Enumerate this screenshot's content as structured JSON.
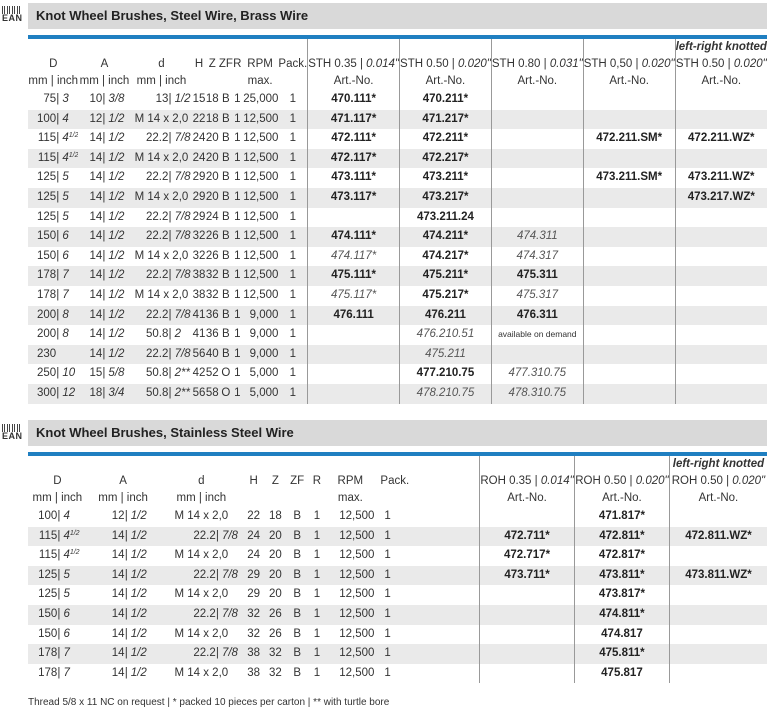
{
  "section1": {
    "ean": "EAN",
    "title": "Knot Wheel Brushes, Steel Wire, Brass Wire",
    "knotted_header": "left-right knotted",
    "hdr": {
      "D": "D",
      "A": "A",
      "d": "d",
      "H": "H",
      "Z": "Z",
      "ZF": "ZF",
      "R": "R",
      "RPM": "RPM",
      "Pack": "Pack.",
      "max": "max.",
      "unit_D": "mm | inch",
      "unit_A": "mm | inch",
      "unit_d": "mm | inch",
      "p1a": "STH 0.35 |",
      "p1b": "0.014\"",
      "p2a": "STH 0.50 |",
      "p2b": "0.020\"",
      "p3a": "STH 0.80 |",
      "p3b": "0.031\"",
      "p4a": "STH 0,50 |",
      "p4b": "0.020\"",
      "p5a": "STH 0.50 |",
      "p5b": "0.020\"",
      "art": "Art.-No."
    },
    "rows": [
      {
        "Dm": "75",
        "Di": "3",
        "Am": "10",
        "Ai": "3/8",
        "dm": "13",
        "di": "1/2",
        "H": "15",
        "Z": "18",
        "ZF": "B",
        "R": "1",
        "RPM": "25,000",
        "P": "1",
        "a1": "470.111*",
        "a2": "470.211*",
        "a3": "",
        "a4": "",
        "a5": ""
      },
      {
        "Dm": "100",
        "Di": "4",
        "Am": "12",
        "Ai": "1/2",
        "dm": "M 14 x 2,0",
        "di": "",
        "H": "22",
        "Z": "18",
        "ZF": "B",
        "R": "1",
        "RPM": "12,500",
        "P": "1",
        "a1": "471.117*",
        "a2": "471.217*",
        "a3": "",
        "a4": "",
        "a5": ""
      },
      {
        "Dm": "115",
        "Di": "4",
        "Dsup": "1/2",
        "Am": "14",
        "Ai": "1/2",
        "dm": "22.2",
        "di": "7/8",
        "H": "24",
        "Z": "20",
        "ZF": "B",
        "R": "1",
        "RPM": "12,500",
        "P": "1",
        "a1": "472.111*",
        "a2": "472.211*",
        "a3": "",
        "a4": "472.211.SM*",
        "a5": "472.211.WZ*"
      },
      {
        "Dm": "115",
        "Di": "4",
        "Dsup": "1/2",
        "Am": "14",
        "Ai": "1/2",
        "dm": "M 14 x 2,0",
        "di": "",
        "H": "24",
        "Z": "20",
        "ZF": "B",
        "R": "1",
        "RPM": "12,500",
        "P": "1",
        "a1": "472.117*",
        "a2": "472.217*",
        "a3": "",
        "a4": "",
        "a5": ""
      },
      {
        "Dm": "125",
        "Di": "5",
        "Am": "14",
        "Ai": "1/2",
        "dm": "22.2",
        "di": "7/8",
        "H": "29",
        "Z": "20",
        "ZF": "B",
        "R": "1",
        "RPM": "12,500",
        "P": "1",
        "a1": "473.111*",
        "a2": "473.211*",
        "a3": "",
        "a4": "473.211.SM*",
        "a5": "473.211.WZ*"
      },
      {
        "Dm": "125",
        "Di": "5",
        "Am": "14",
        "Ai": "1/2",
        "dm": "M 14 x 2,0",
        "di": "",
        "H": "29",
        "Z": "20",
        "ZF": "B",
        "R": "1",
        "RPM": "12,500",
        "P": "1",
        "a1": "473.117*",
        "a2": "473.217*",
        "a3": "",
        "a4": "",
        "a5": "473.217.WZ*"
      },
      {
        "Dm": "125",
        "Di": "5",
        "Am": "14",
        "Ai": "1/2",
        "dm": "22.2",
        "di": "7/8",
        "H": "29",
        "Z": "24",
        "ZF": "B",
        "R": "1",
        "RPM": "12,500",
        "P": "1",
        "a1": "",
        "a2": "473.211.24",
        "a3": "",
        "a4": "",
        "a5": ""
      },
      {
        "Dm": "150",
        "Di": "6",
        "Am": "14",
        "Ai": "1/2",
        "dm": "22.2",
        "di": "7/8",
        "H": "32",
        "Z": "26",
        "ZF": "B",
        "R": "1",
        "RPM": "12,500",
        "P": "1",
        "a1": "474.111*",
        "a2": "474.211*",
        "a3": "474.311",
        "a4": "",
        "a5": ""
      },
      {
        "Dm": "150",
        "Di": "6",
        "Am": "14",
        "Ai": "1/2",
        "dm": "M 14 x 2,0",
        "di": "",
        "H": "32",
        "Z": "26",
        "ZF": "B",
        "R": "1",
        "RPM": "12,500",
        "P": "1",
        "a1": "474.117*",
        "a2": "474.217*",
        "a3": "474.317",
        "a4": "",
        "a5": ""
      },
      {
        "Dm": "178",
        "Di": "7",
        "Am": "14",
        "Ai": "1/2",
        "dm": "22.2",
        "di": "7/8",
        "H": "38",
        "Z": "32",
        "ZF": "B",
        "R": "1",
        "RPM": "12,500",
        "P": "1",
        "a1": "475.111*",
        "a2": "475.211*",
        "a3": "475.311",
        "a4": "",
        "a5": ""
      },
      {
        "Dm": "178",
        "Di": "7",
        "Am": "14",
        "Ai": "1/2",
        "dm": "M 14 x 2,0",
        "di": "",
        "H": "38",
        "Z": "32",
        "ZF": "B",
        "R": "1",
        "RPM": "12,500",
        "P": "1",
        "a1": "475.117*",
        "a2": "475.217*",
        "a3": "475.317",
        "a4": "",
        "a5": ""
      },
      {
        "Dm": "200",
        "Di": "8",
        "Am": "14",
        "Ai": "1/2",
        "dm": "22.2",
        "di": "7/8",
        "H": "41",
        "Z": "36",
        "ZF": "B",
        "R": "1",
        "RPM": "9,000",
        "P": "1",
        "a1": "476.111",
        "a2": "476.211",
        "a3": "476.311",
        "a4": "",
        "a5": ""
      },
      {
        "Dm": "200",
        "Di": "8",
        "Am": "14",
        "Ai": "1/2",
        "dm": "50.8",
        "di": "2",
        "H": "41",
        "Z": "36",
        "ZF": "B",
        "R": "1",
        "RPM": "9,000",
        "P": "1",
        "a1": "",
        "a2": "476.210.51",
        "a3": "available on demand",
        "a4": "",
        "a5": ""
      },
      {
        "Dm": "230",
        "Di": "",
        "Am": "14",
        "Ai": "1/2",
        "dm": "22.2",
        "di": "7/8",
        "H": "56",
        "Z": "40",
        "ZF": "B",
        "R": "1",
        "RPM": "9,000",
        "P": "1",
        "a1": "",
        "a2": "475.211",
        "a3": "",
        "a4": "",
        "a5": ""
      },
      {
        "Dm": "250",
        "Di": "10",
        "Am": "15",
        "Ai": "5/8",
        "dm": "50.8",
        "di": "2**",
        "H": "42",
        "Z": "52",
        "ZF": "O",
        "R": "1",
        "RPM": "5,000",
        "P": "1",
        "a1": "",
        "a2": "477.210.75",
        "a3": "477.310.75",
        "a4": "",
        "a5": ""
      },
      {
        "Dm": "300",
        "Di": "12",
        "Am": "18",
        "Ai": "3/4",
        "dm": "50.8",
        "di": "2**",
        "H": "56",
        "Z": "58",
        "ZF": "O",
        "R": "1",
        "RPM": "5,000",
        "P": "1",
        "a1": "",
        "a2": "478.210.75",
        "a3": "478.310.75",
        "a4": "",
        "a5": ""
      }
    ]
  },
  "section2": {
    "ean": "EAN",
    "title": "Knot Wheel Brushes, Stainless Steel Wire",
    "knotted_header": "left-right knotted",
    "hdr": {
      "D": "D",
      "A": "A",
      "d": "d",
      "H": "H",
      "Z": "Z",
      "ZF": "ZF",
      "R": "R",
      "RPM": "RPM",
      "Pack": "Pack.",
      "max": "max.",
      "unit_D": "mm | inch",
      "unit_A": "mm | inch",
      "unit_d": "mm | inch",
      "p1a": "ROH 0.35 |",
      "p1b": "0.014\"",
      "p2a": "ROH 0.50 |",
      "p2b": "0.020\"",
      "p3a": "ROH 0.50 |",
      "p3b": "0.020\"",
      "art": "Art.-No."
    },
    "rows": [
      {
        "Dm": "100",
        "Di": "4",
        "Am": "12",
        "Ai": "1/2",
        "dm": "M 14 x 2,0",
        "di": "",
        "H": "22",
        "Z": "18",
        "ZF": "B",
        "R": "1",
        "RPM": "12,500",
        "P": "1",
        "a1": "",
        "a2": "471.817*",
        "a3": ""
      },
      {
        "Dm": "115",
        "Di": "4",
        "Dsup": "1/2",
        "Am": "14",
        "Ai": "1/2",
        "dm": "22.2",
        "di": "7/8",
        "H": "24",
        "Z": "20",
        "ZF": "B",
        "R": "1",
        "RPM": "12,500",
        "P": "1",
        "a1": "472.711*",
        "a2": "472.811*",
        "a3": "472.811.WZ*"
      },
      {
        "Dm": "115",
        "Di": "4",
        "Dsup": "1/2",
        "Am": "14",
        "Ai": "1/2",
        "dm": "M 14 x 2,0",
        "di": "",
        "H": "24",
        "Z": "20",
        "ZF": "B",
        "R": "1",
        "RPM": "12,500",
        "P": "1",
        "a1": "472.717*",
        "a2": "472.817*",
        "a3": ""
      },
      {
        "Dm": "125",
        "Di": "5",
        "Am": "14",
        "Ai": "1/2",
        "dm": "22.2",
        "di": "7/8",
        "H": "29",
        "Z": "20",
        "ZF": "B",
        "R": "1",
        "RPM": "12,500",
        "P": "1",
        "a1": "473.711*",
        "a2": "473.811*",
        "a3": "473.811.WZ*"
      },
      {
        "Dm": "125",
        "Di": "5",
        "Am": "14",
        "Ai": "1/2",
        "dm": "M 14 x 2,0",
        "di": "",
        "H": "29",
        "Z": "20",
        "ZF": "B",
        "R": "1",
        "RPM": "12,500",
        "P": "1",
        "a1": "",
        "a2": "473.817*",
        "a3": ""
      },
      {
        "Dm": "150",
        "Di": "6",
        "Am": "14",
        "Ai": "1/2",
        "dm": "22.2",
        "di": "7/8",
        "H": "32",
        "Z": "26",
        "ZF": "B",
        "R": "1",
        "RPM": "12,500",
        "P": "1",
        "a1": "",
        "a2": "474.811*",
        "a3": ""
      },
      {
        "Dm": "150",
        "Di": "6",
        "Am": "14",
        "Ai": "1/2",
        "dm": "M 14 x 2,0",
        "di": "",
        "H": "32",
        "Z": "26",
        "ZF": "B",
        "R": "1",
        "RPM": "12,500",
        "P": "1",
        "a1": "",
        "a2": "474.817",
        "a3": ""
      },
      {
        "Dm": "178",
        "Di": "7",
        "Am": "14",
        "Ai": "1/2",
        "dm": "22.2",
        "di": "7/8",
        "H": "38",
        "Z": "32",
        "ZF": "B",
        "R": "1",
        "RPM": "12,500",
        "P": "1",
        "a1": "",
        "a2": "475.811*",
        "a3": ""
      },
      {
        "Dm": "178",
        "Di": "7",
        "Am": "14",
        "Ai": "1/2",
        "dm": "M 14 x 2,0",
        "di": "",
        "H": "38",
        "Z": "32",
        "ZF": "B",
        "R": "1",
        "RPM": "12,500",
        "P": "1",
        "a1": "",
        "a2": "475.817",
        "a3": ""
      }
    ]
  },
  "footnote": "Thread 5/8 x 11 NC on request  |  * packed 10 pieces per carton  |  ** with turtle bore"
}
